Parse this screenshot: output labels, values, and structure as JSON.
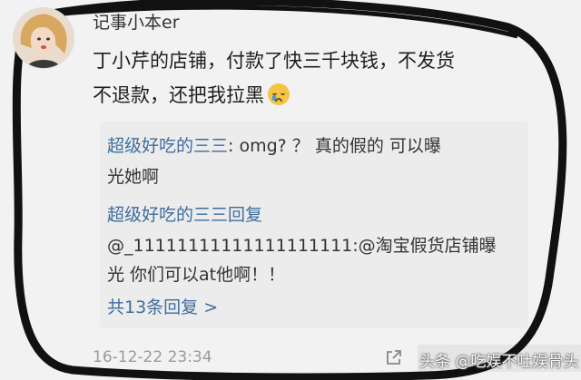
{
  "post": {
    "username": "记事小本er",
    "text_line1": "丁小芹的店铺，付款了快三千块钱，不发货",
    "text_line2": "不退款，还把我拉黑",
    "emoji": "crying-face-emoji",
    "timestamp": "16-12-22 23:34"
  },
  "replies": {
    "line1_nick": "超级好吃的三三",
    "line1_text": ": omg? ？ 真的假的 可以曝",
    "line2": "光她啊",
    "line3_nick": "超级好吃的三三回复",
    "line4": "@_11111111111111111111:@淘宝假货店铺曝",
    "line5": "光 你们可以at他啊！！",
    "more": "共13条回复 >"
  },
  "watermark": "头条 @吃娱不吐娱骨头",
  "colors": {
    "link": "#3e6d9e",
    "annotation": "#111111"
  }
}
